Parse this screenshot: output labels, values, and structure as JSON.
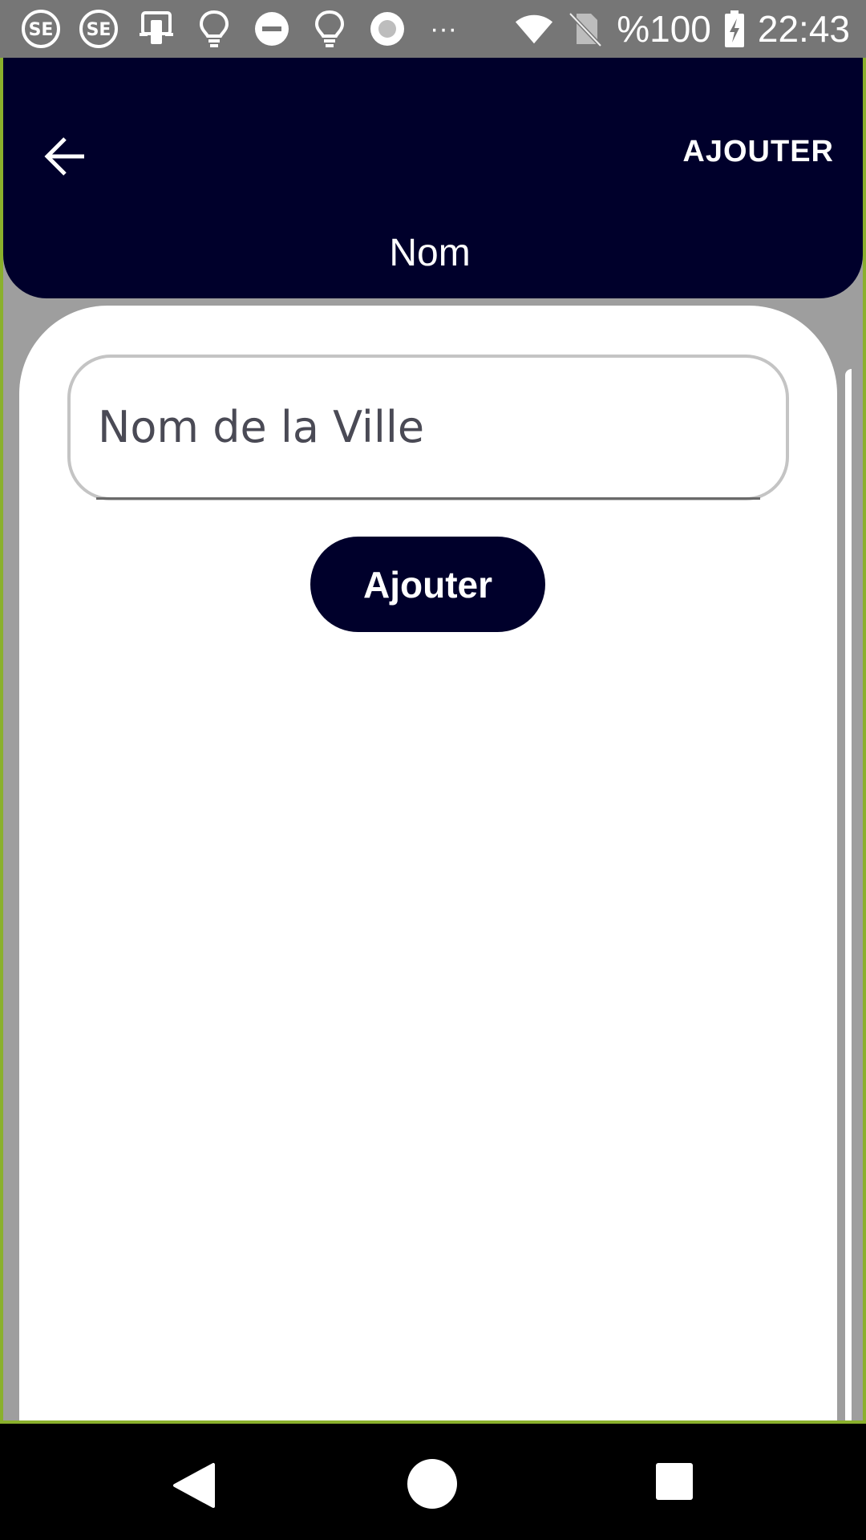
{
  "status_bar": {
    "icons": [
      "sf-icon",
      "sf-icon",
      "device-icon",
      "lightbulb-icon",
      "do-not-disturb-icon",
      "lightbulb-icon",
      "record-icon",
      "more-dots-icon",
      "wifi-icon",
      "no-sim-icon",
      "battery-charging-icon"
    ],
    "more_dots": "···",
    "battery_text": "%100",
    "time": "22:43"
  },
  "app_bar": {
    "back_icon": "arrow-left-icon",
    "action_label": "AJOUTER",
    "title": "Nom"
  },
  "form": {
    "city_input_placeholder": "Nom de la Ville",
    "city_input_value": "",
    "add_button_label": "Ajouter"
  },
  "nav_bar": {
    "icons": [
      "nav-back-icon",
      "nav-home-icon",
      "nav-recents-icon"
    ]
  },
  "colors": {
    "app_bar": "#00002b",
    "button": "#00002b",
    "status_bar": "#767676",
    "backdrop": "#9e9e9e",
    "frame": "#8ab02c"
  }
}
